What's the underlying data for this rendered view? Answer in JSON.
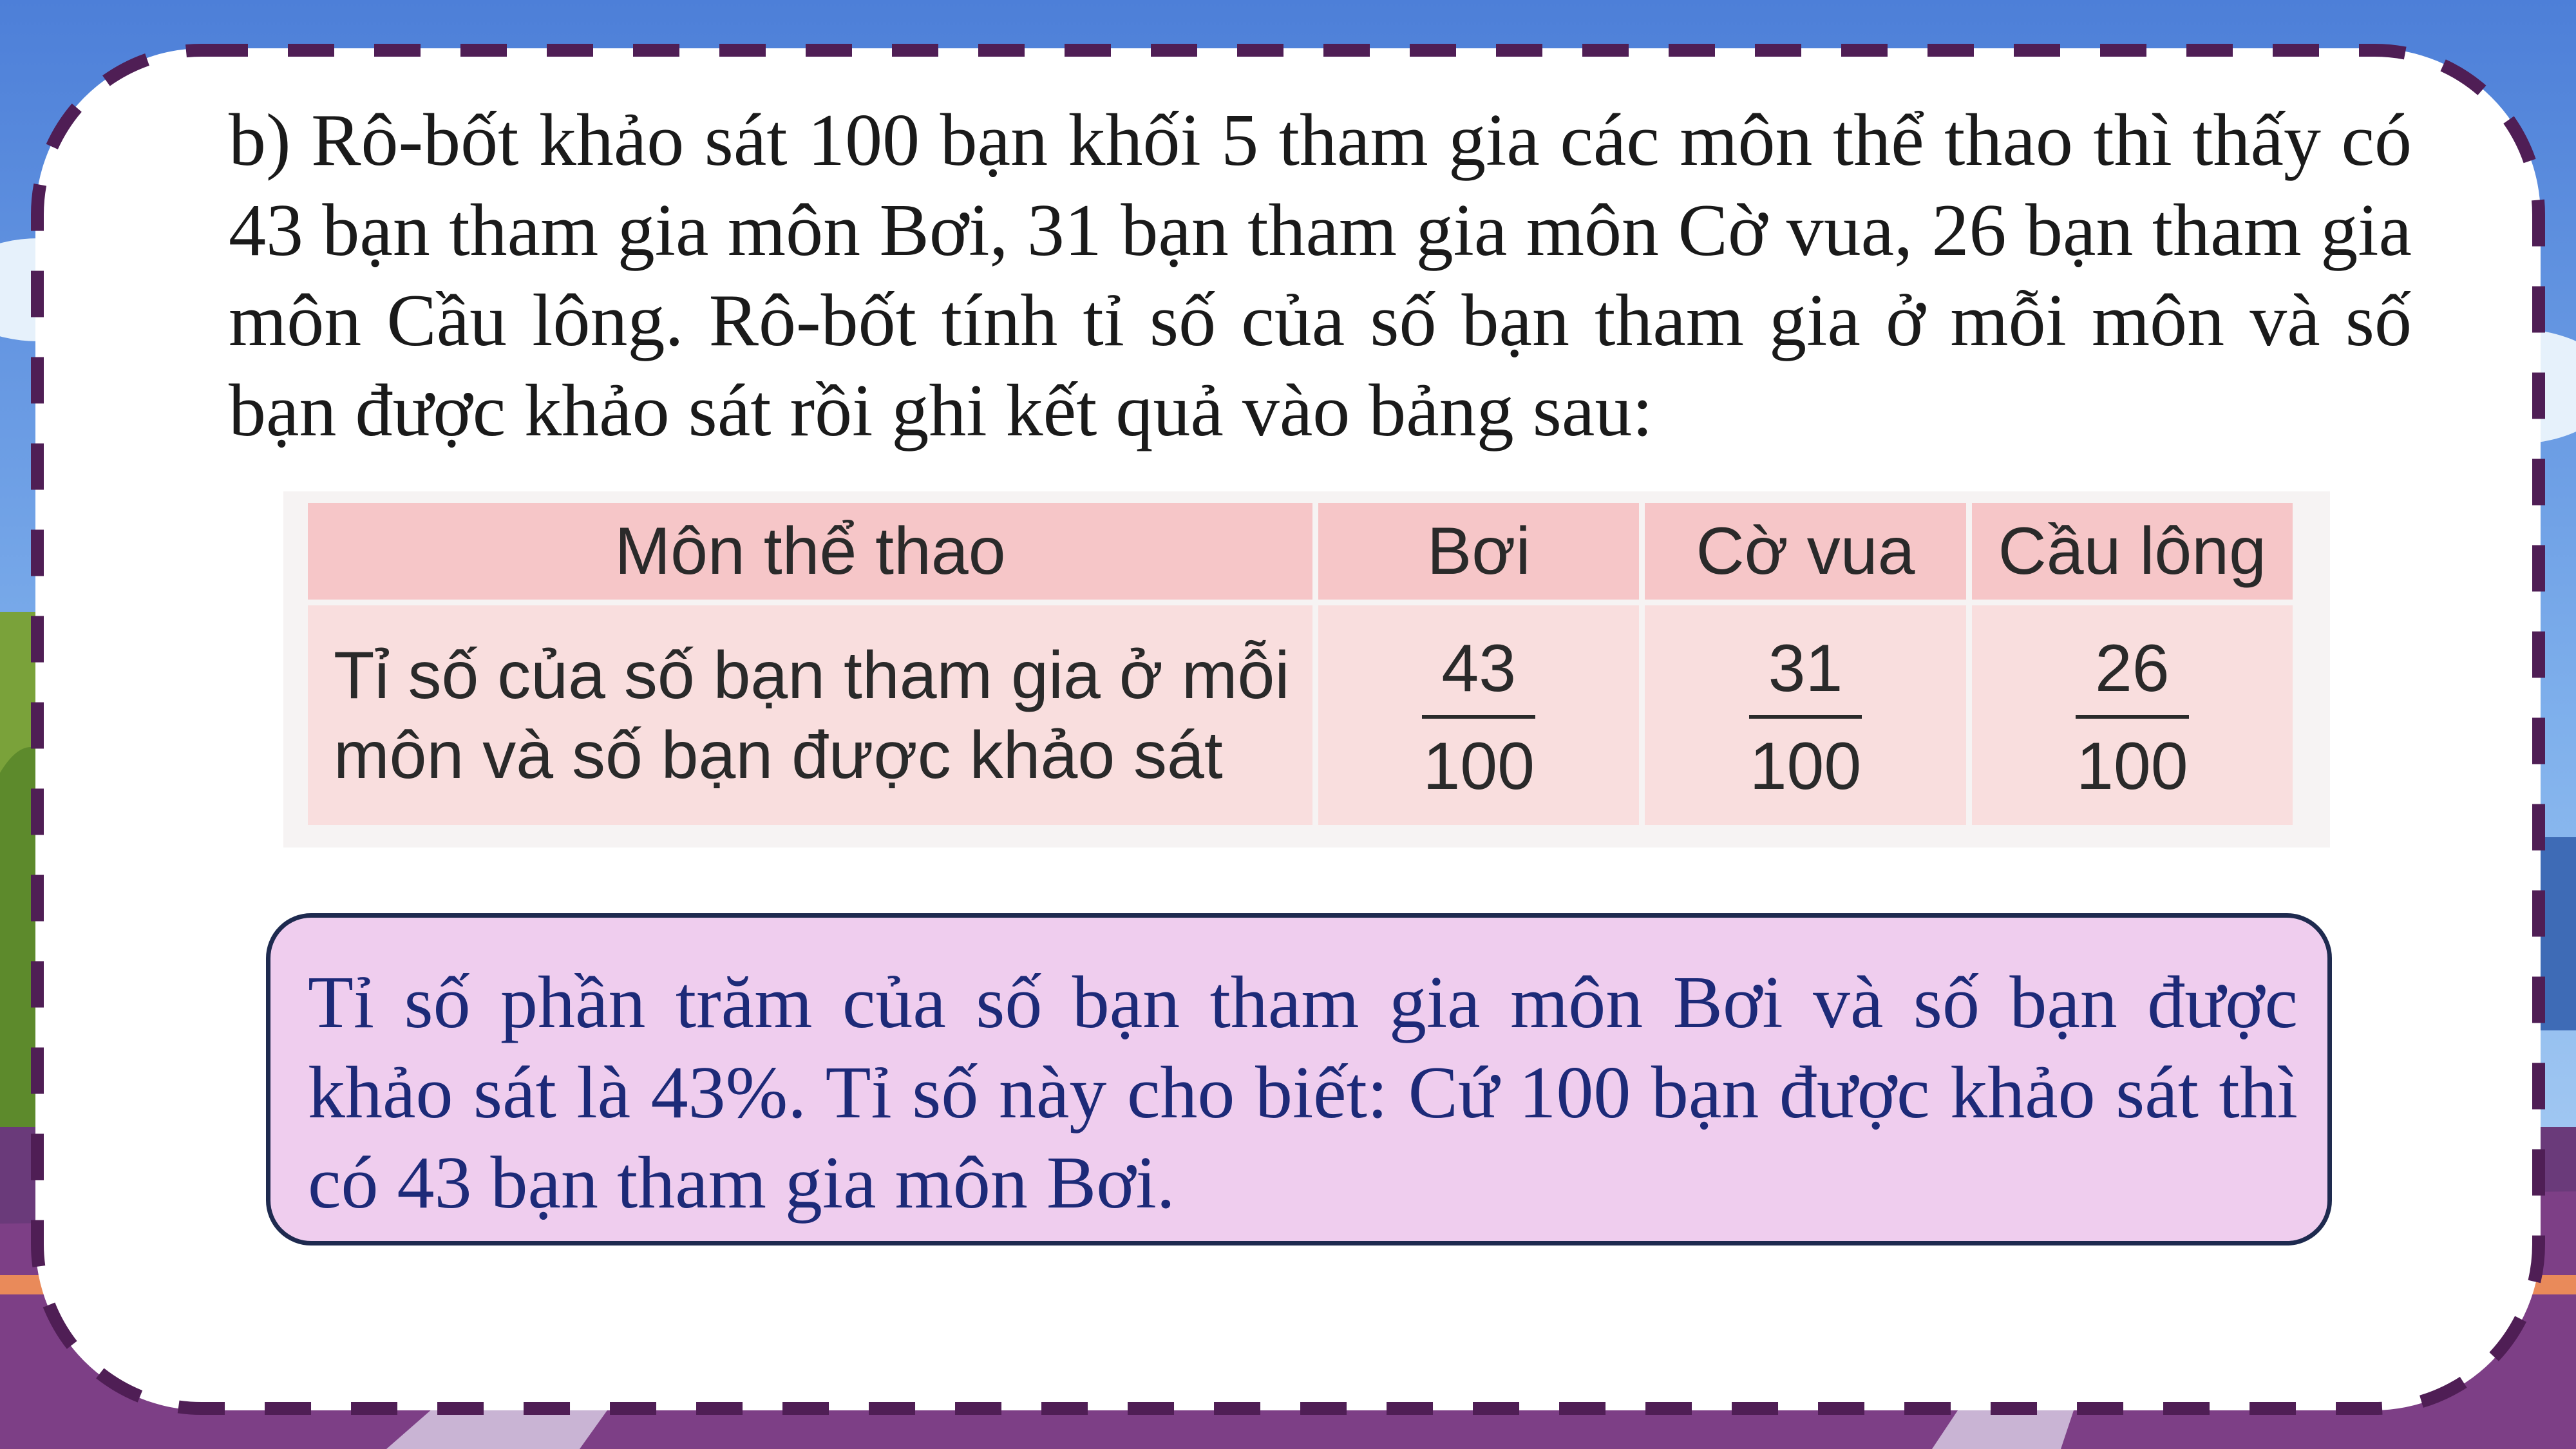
{
  "intro_text": "b) Rô-bốt khảo sát 100 bạn khối 5 tham gia các môn thể thao thì thấy có 43 bạn tham gia môn Bơi, 31 bạn tham gia môn Cờ vua, 26 bạn tham gia môn Cầu lông. Rô-bốt tính tỉ số của số bạn tham gia ở mỗi môn và số bạn được khảo sát rồi ghi kết quả vào bảng sau:",
  "table": {
    "header_label": "Môn thể thao",
    "columns": [
      "Bơi",
      "Cờ vua",
      "Cầu lông"
    ],
    "row_label_line1": "Tỉ số của số bạn tham gia ở mỗi",
    "row_label_line2": "môn và số bạn được khảo sát",
    "ratios": [
      {
        "numerator": "43",
        "denominator": "100"
      },
      {
        "numerator": "31",
        "denominator": "100"
      },
      {
        "numerator": "26",
        "denominator": "100"
      }
    ]
  },
  "note_text": "Tỉ số phần trăm của số bạn tham gia môn Bơi và số bạn được khảo sát là 43%. Tỉ số này cho biết: Cứ 100 bạn được khảo sát thì có 43 bạn tham gia môn Bơi.",
  "colors": {
    "sky": "#5a8fe0",
    "card_border": "#4f1e55",
    "table_header": "#f6c6c8",
    "table_cell": "#f9dede",
    "note_background": "#efcdee",
    "note_text": "#1d2a78"
  }
}
